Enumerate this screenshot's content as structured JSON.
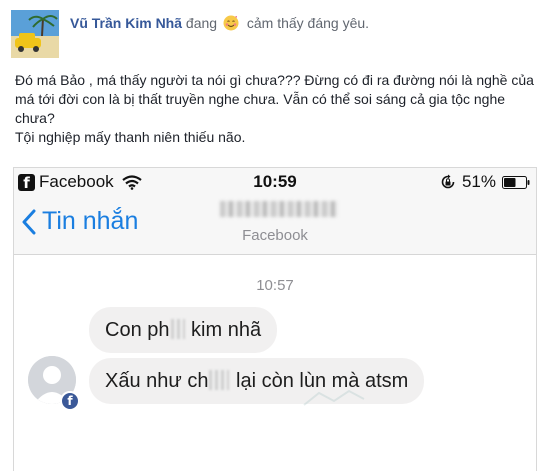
{
  "post": {
    "author": "Vũ Trần Kim Nhã",
    "verb": "đang",
    "feeling": "cảm thấy đáng yêu.",
    "text_lines": [
      "Đó má Bảo , má thấy người ta nói gì chưa??? Đừng có đi ra đường nói là nghề của má tới đời con là bị thất truyền nghe chưa. Vẫn có thể soi sáng cả gia tộc nghe chưa?",
      "Tội nghiệp mấy thanh niên thiếu não."
    ]
  },
  "screenshot": {
    "status_bar": {
      "carrier": "Facebook",
      "time": "10:59",
      "battery": "51%",
      "icons": [
        "facebook-square-icon",
        "wifi-icon",
        "rotation-lock-icon",
        "battery-icon"
      ]
    },
    "nav": {
      "back_label": "Tin nhắn",
      "subtitle": "Facebook"
    },
    "chat": {
      "timestamp": "10:57",
      "messages": [
        {
          "before": "Con ph",
          "after": " kim nhã"
        },
        {
          "before": "Xấu như ch",
          "after": " lại còn lùn mà atsm"
        }
      ]
    }
  },
  "colors": {
    "author": "#365899",
    "ios_blue": "#1a7ee0",
    "bubble": "#f1f0f0",
    "bar": "#f7f7f7"
  }
}
